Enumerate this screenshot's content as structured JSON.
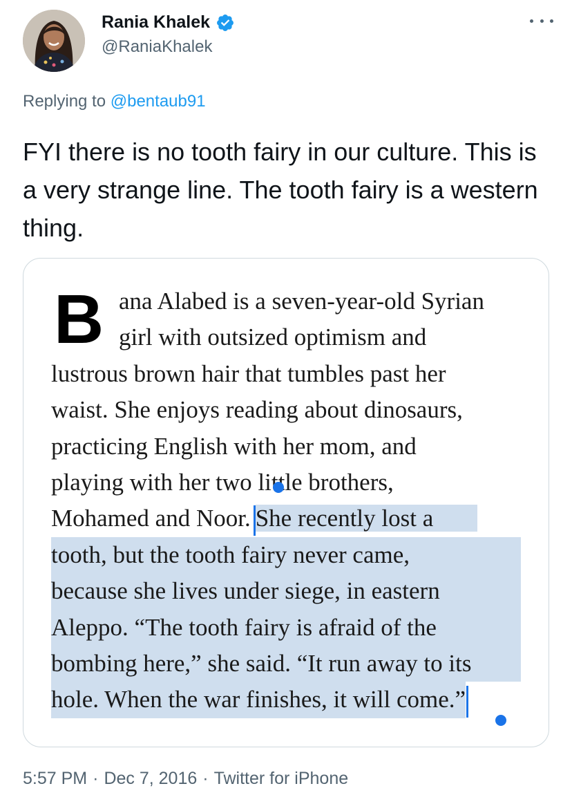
{
  "author": {
    "display_name": "Rania Khalek",
    "handle": "@RaniaKhalek",
    "verified": true,
    "avatar_icon": "profile-photo"
  },
  "reply": {
    "prefix": "Replying to",
    "to_handle": "@bentaub91"
  },
  "tweet": {
    "text": "FYI there is no tooth fairy in our culture. This is a very strange line. The tooth fairy is a western thing."
  },
  "attached_image": {
    "drop_cap": "B",
    "lines": [
      "ana Alabed is a seven-year-old Syrian",
      "girl with outsized optimism and",
      "lustrous brown hair that tumbles past her",
      "waist. She enjoys reading about dinosaurs,",
      "practicing English with her mom, and",
      "playing with her two little brothers,",
      "Mohamed and Noor.",
      "She recently lost a",
      "tooth, but the tooth fairy never came,",
      "because she lives under siege, in eastern",
      "Aleppo. “The tooth fairy is afraid of the",
      "bombing here,” she said. “It run away to its",
      "hole. When the war finishes, it will come.”"
    ],
    "highlight_color": "#cfdeee",
    "selection_handle_color": "#1a73e8"
  },
  "meta": {
    "time": "5:57 PM",
    "date": "Dec 7, 2016",
    "source": "Twitter for iPhone",
    "separator": "·"
  },
  "colors": {
    "link": "#1d9bf0",
    "secondary_text": "#536471",
    "verified_badge": "#1d9bf0"
  }
}
